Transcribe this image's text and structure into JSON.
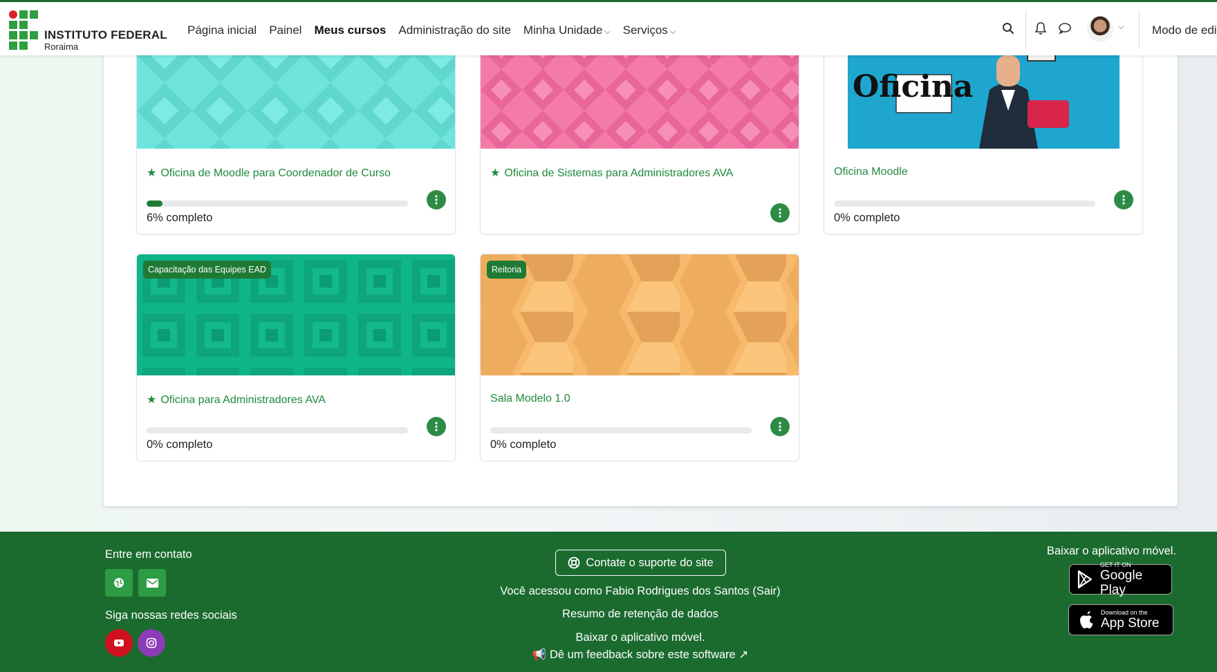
{
  "brand": {
    "title": "INSTITUTO FEDERAL",
    "subtitle": "Roraima"
  },
  "nav": {
    "items": [
      {
        "label": "Página inicial",
        "active": false,
        "dropdown": false
      },
      {
        "label": "Painel",
        "active": false,
        "dropdown": false
      },
      {
        "label": "Meus cursos",
        "active": true,
        "dropdown": false
      },
      {
        "label": "Administração do site",
        "active": false,
        "dropdown": false
      },
      {
        "label": "Minha Unidade",
        "active": false,
        "dropdown": true
      },
      {
        "label": "Serviços",
        "active": false,
        "dropdown": true
      }
    ],
    "edit_mode_label": "Modo de edi",
    "icons": [
      "search-icon",
      "bell-icon",
      "chat-icon",
      "user-avatar",
      "chevron-down-icon"
    ]
  },
  "courses": [
    {
      "category": "",
      "title": "Oficina de Moodle para Coordenador de Curso",
      "starred": true,
      "progress_pct": 6,
      "progress_label": "6% completo",
      "image": "teal-diamond-pattern",
      "image_color": "#6fe4dc"
    },
    {
      "category": "",
      "title": "Oficina de Sistemas para Administradores AVA",
      "starred": true,
      "progress_pct": null,
      "progress_label": "",
      "image": "pink-diamond-pattern",
      "image_color": "#f47ba8"
    },
    {
      "category": "",
      "title": "Oficina Moodle",
      "starred": false,
      "progress_pct": 0,
      "progress_label": "0% completo",
      "image": "oficina-moodle-illustration",
      "image_color": "#1ea6cf",
      "image_text": "Oficina"
    },
    {
      "category": "Capacitação das Equipes EAD",
      "title": "Oficina para Administradores AVA",
      "starred": true,
      "progress_pct": 0,
      "progress_label": "0% completo",
      "image": "green-square-pattern",
      "image_color": "#10b489"
    },
    {
      "category": "Reitoria",
      "title": "Sala Modelo 1.0",
      "starred": false,
      "progress_pct": 0,
      "progress_label": "0% completo",
      "image": "orange-hexagon-pattern",
      "image_color": "#f7b96b"
    }
  ],
  "footer": {
    "contact_heading": "Entre em contato",
    "social_heading": "Siga nossas redes sociais",
    "support_button": "Contate o suporte do site",
    "logged_in_text": "Você acessou como Fabio Rodrigues dos Santos (Sair)",
    "data_retention": "Resumo de retenção de dados",
    "app_link": "Baixar o aplicativo móvel.",
    "feedback": "Dê um feedback sobre este software",
    "app_heading": "Baixar o aplicativo móvel.",
    "google_play_small": "GET IT ON",
    "google_play_big": "Google Play",
    "app_store_small": "Download on the",
    "app_store_big": "App Store",
    "colors": {
      "footer_bg": "#1b6b2f",
      "accent": "#1f8a3c",
      "youtube": "#d0101f",
      "instagram": "#8c3cb6"
    }
  }
}
